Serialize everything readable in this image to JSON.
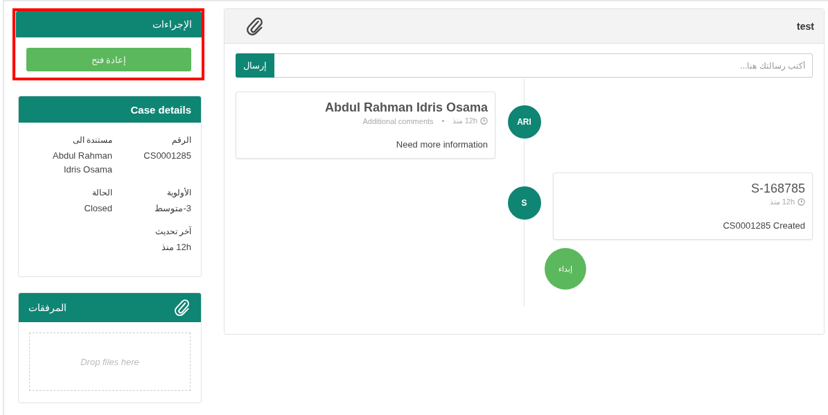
{
  "actions_panel": {
    "title": "الإجراءات",
    "highlighted": true,
    "button": "إعادة فتح"
  },
  "case_details": {
    "title": "Case details",
    "fields": [
      {
        "label": "الرقم",
        "value": "CS0001285"
      },
      {
        "label": "مستندة الى",
        "value": "Abdul Rahman Idris Osama"
      },
      {
        "label": "الأولوية",
        "value": "3-متوسط"
      },
      {
        "label": "الحالة",
        "value": "Closed"
      },
      {
        "label": "آخر تحديث",
        "value": "12h منذ"
      }
    ]
  },
  "attachments": {
    "title": "المرفقات",
    "dropzone": "Drop files here"
  },
  "conversation": {
    "title": "test",
    "message_placeholder": "أكتب رسالتك هنا...",
    "send_button": "إرسال",
    "timeline": [
      {
        "kind": "left",
        "avatar": "ARI",
        "author": "Abdul Rahman Idris Osama",
        "time": "12h منذ",
        "type": "Additional comments",
        "text": "Need more information"
      },
      {
        "kind": "right",
        "avatar": "S",
        "author": "S-168785",
        "time": "12h منذ",
        "text": "CS0001285 Created"
      }
    ],
    "start": "إبداء"
  }
}
